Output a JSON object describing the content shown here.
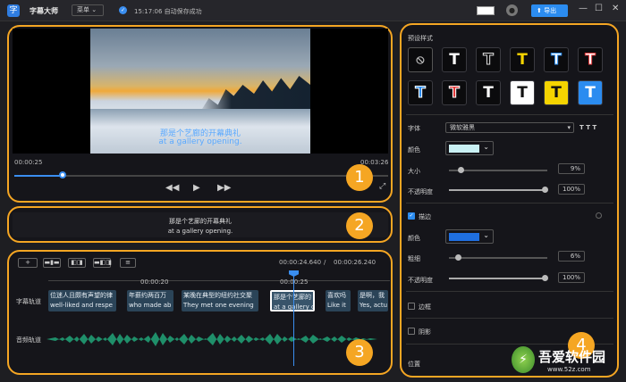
{
  "titlebar": {
    "logo_glyph": "字",
    "app_name": "字幕大师",
    "menu_label": "菜单 ⌄",
    "check_glyph": "✓",
    "status_text": "15:17:06 自动保存成功",
    "export_label": "⬆ 导出",
    "win_min": "—",
    "win_max": "☐",
    "win_close": "✕"
  },
  "preview": {
    "subtitle_cn": "那是个艺廊的开幕典礼",
    "subtitle_en": "at a gallery opening.",
    "time_current": "00:00:25",
    "time_total": "00:03:26",
    "progress": 0.13,
    "ctrl_prev": "◀◀",
    "ctrl_play": "▶",
    "ctrl_next": "▶▶",
    "ctrl_full": "⤢"
  },
  "caption_box": {
    "line_cn": "那是个艺廊的开幕典礼",
    "line_en": "at a gallery opening."
  },
  "timeline": {
    "add_label": "+",
    "tool_btns": [
      "▬▮▬",
      "◧◨",
      "▬◧◨",
      "≡"
    ],
    "time_current": "00:00:24.640",
    "time_sep": "/",
    "time_total": "00:00:26.240",
    "ruler_labels": [
      "00:00:20",
      "00:00:25"
    ],
    "track_subtitle_label": "字幕轨道",
    "track_audio_label": "音频轨道",
    "clips": [
      {
        "cn": "位迷人且颇有声望的律",
        "en": "well-liked and respe"
      },
      {
        "cn": "年薪约两百万",
        "en": "who made ab"
      },
      {
        "cn": "某晚在典型的纽约社交聚",
        "en": "They met one evening"
      },
      {
        "cn": "那是个艺廊的",
        "en": "at a gallery o"
      },
      {
        "cn": "喜欢吗",
        "en": "Like it"
      },
      {
        "cn": "是啊，我",
        "en": "Yes, actu"
      }
    ]
  },
  "style_panel": {
    "title": "预设样式",
    "presets": [
      {
        "glyph": "⃠",
        "color": "#bbbbbb",
        "bg": "#0b0b0d"
      },
      {
        "glyph": "T",
        "color": "#ffffff",
        "bg": "#0b0b0d"
      },
      {
        "glyph": "T",
        "color": "#0b0b0d",
        "bg": "#0b0b0d",
        "stroke": "#dddddd"
      },
      {
        "glyph": "T",
        "color": "#f5d400",
        "bg": "#0b0b0d"
      },
      {
        "glyph": "T",
        "color": "#ffffff",
        "bg": "#0b0b0d",
        "stroke": "#2b8cf0"
      },
      {
        "glyph": "T",
        "color": "#ffffff",
        "bg": "#0b0b0d",
        "stroke": "#e23b3b"
      },
      {
        "glyph": "T",
        "color": "#2b8cf0",
        "bg": "#0b0b0d",
        "stroke": "#ffffff"
      },
      {
        "glyph": "T",
        "color": "#e23b3b",
        "bg": "#0b0b0d",
        "stroke": "#ffffff"
      },
      {
        "glyph": "T",
        "color": "#ffffff",
        "bg": "#0b0b0d"
      },
      {
        "glyph": "T",
        "color": "#111111",
        "bg": "#ffffff"
      },
      {
        "glyph": "T",
        "color": "#111111",
        "bg": "#f5d400"
      },
      {
        "glyph": "T",
        "color": "#ffffff",
        "bg": "#2b8cf0"
      }
    ],
    "font_label": "字体",
    "font_value": "微软雅黑",
    "font_style_icons": "T T T",
    "color_label": "颜色",
    "text_color": "#c9f1f4",
    "size_label": "大小",
    "size_value": "9%",
    "size_level": 0.09,
    "opacity_label": "不透明度",
    "opacity_value": "100%",
    "stroke_label": "描边",
    "stroke_check": "✓",
    "stroke_color_label": "颜色",
    "stroke_color": "#1f6fe0",
    "thickness_label": "粗细",
    "thickness_value": "6%",
    "thickness_level": 0.06,
    "stroke_opacity_label": "不透明度",
    "stroke_opacity_value": "100%",
    "border_label": "边框",
    "shadow_label": "阴影",
    "position_label": "位置"
  },
  "badges": [
    "1",
    "2",
    "3",
    "4"
  ],
  "watermark": {
    "cn": "吾爱软件园",
    "url": "www.52z.com"
  },
  "accent": "#f5a623"
}
